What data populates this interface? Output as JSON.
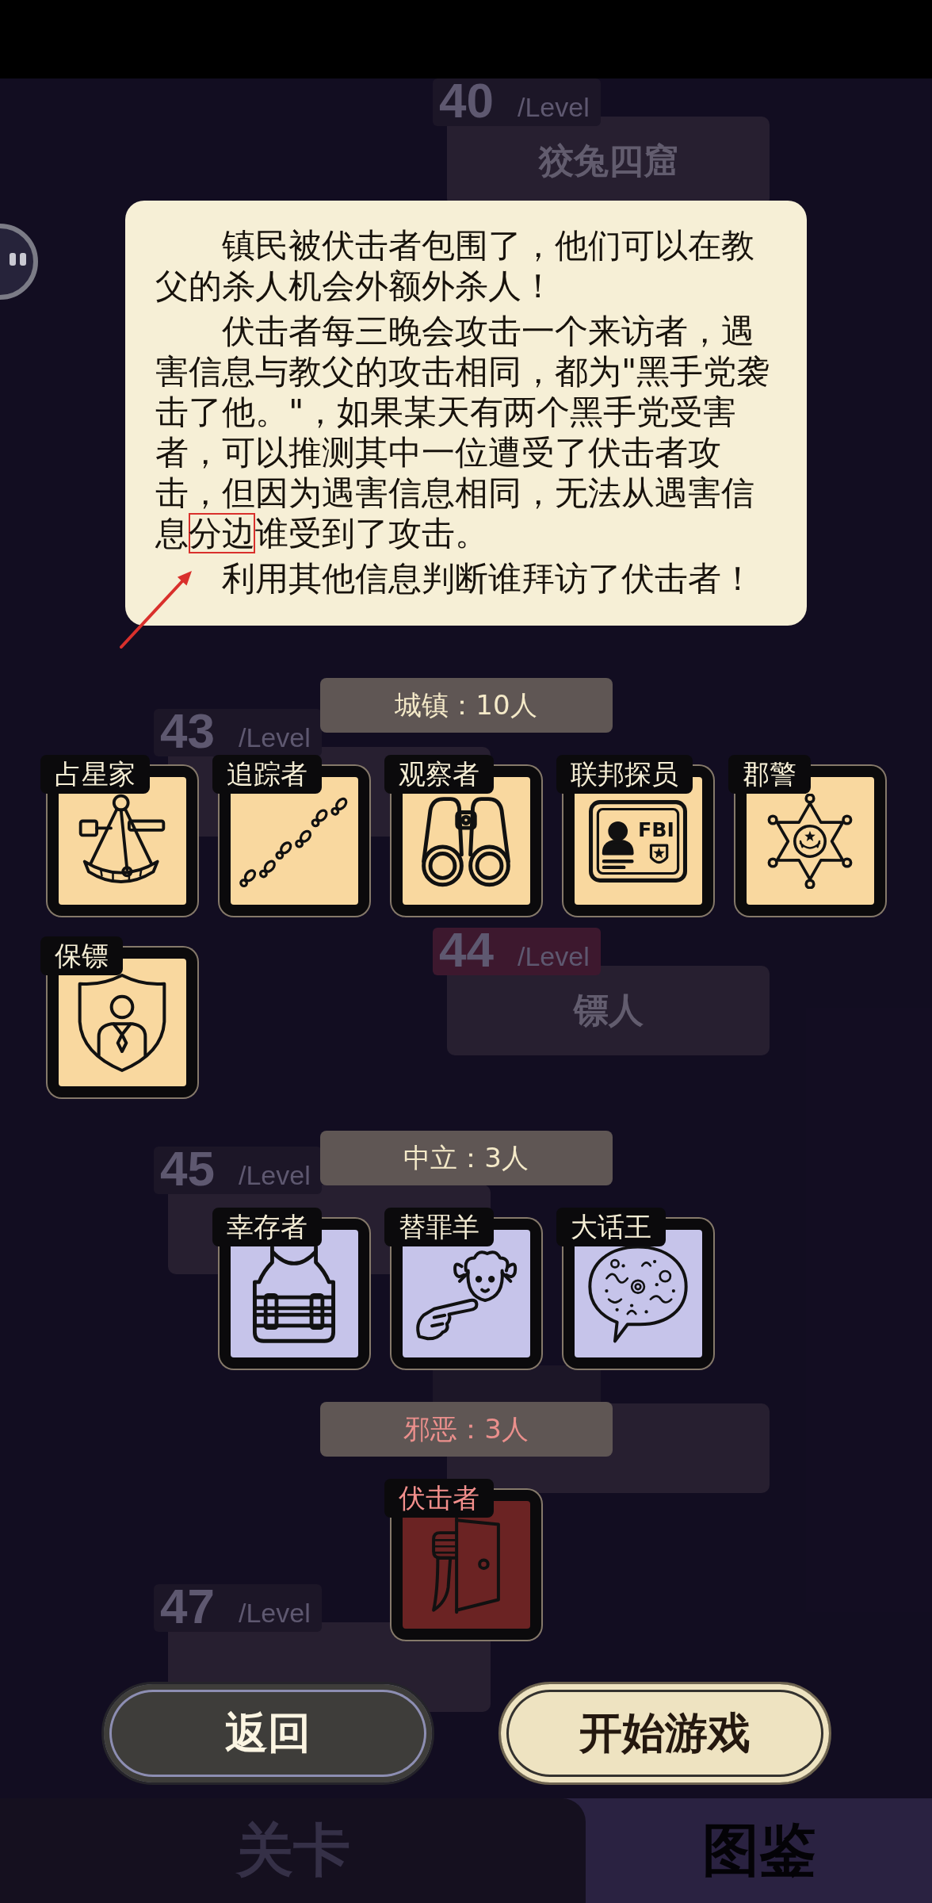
{
  "level_map": {
    "levels": [
      {
        "number": "40",
        "unit": "/Level",
        "name": "狡兔四窟",
        "selected": false
      },
      {
        "number": "43",
        "unit": "/Level",
        "selected": false
      },
      {
        "number": "44",
        "unit": "/Level",
        "name": "镖人",
        "selected": true
      },
      {
        "number": "45",
        "unit": "/Level",
        "selected": false
      },
      {
        "selected": false
      },
      {
        "number": "47",
        "unit": "/Level",
        "selected": false
      }
    ]
  },
  "role_tooltip": {
    "paragraphs": [
      {
        "text": "镇民被伏击者包围了，他们可以在教父的杀人机会外额外杀人！"
      },
      {
        "text": "伏击者每三晚会攻击一个来访者，遇害信息与教父的攻击相同，都为\"黑手党袭击了他。\"，如果某天有两个黑手党受害者，可以推测其中一位遭受了伏击者攻击，但因为遇害信息相同，无法从遇害信息",
        "highlight": "分边",
        "after": "谁受到了攻击。"
      },
      {
        "text": "利用其他信息判断谁拜访了伏击者！"
      }
    ]
  },
  "roster": {
    "sections": [
      {
        "kind": "town",
        "title": "城镇：10人",
        "roles": [
          {
            "name": "占星家"
          },
          {
            "name": "追踪者"
          },
          {
            "name": "观察者"
          },
          {
            "name": "联邦探员",
            "icon_text": "FBI"
          },
          {
            "name": "郡警"
          },
          {
            "name": "保镖"
          }
        ]
      },
      {
        "kind": "neutral",
        "title": "中立：3人",
        "roles": [
          {
            "name": "幸存者"
          },
          {
            "name": "替罪羊"
          },
          {
            "name": "大话王"
          }
        ]
      },
      {
        "kind": "evil",
        "title": "邪恶：3人",
        "roles": [
          {
            "name": "伏击者"
          }
        ]
      }
    ]
  },
  "actions": [
    {
      "label": "返回",
      "kind": "secondary"
    },
    {
      "label": "开始游戏",
      "kind": "primary"
    }
  ],
  "tab_bar": {
    "tabs": [
      {
        "label": "关卡",
        "selected": true
      },
      {
        "label": "图鉴",
        "selected": false
      }
    ]
  }
}
